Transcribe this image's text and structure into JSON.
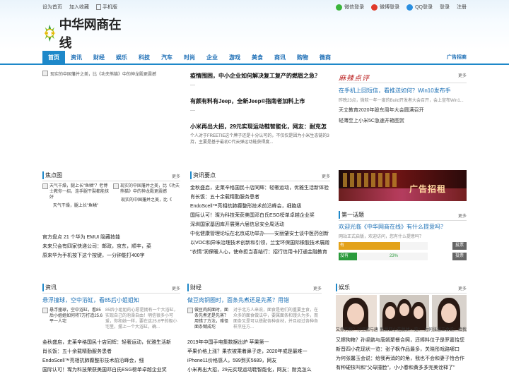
{
  "topbar": {
    "set_home": "设为首页",
    "bookmark": "加入收藏",
    "mobile": "手机版",
    "wechat_login": "微信登录",
    "weibo_login": "微博登录",
    "qq_login": "QQ登录",
    "login": "登录",
    "register": "注册"
  },
  "logo": {
    "text": "中华网商在线"
  },
  "nav": {
    "items": [
      "首页",
      "资讯",
      "财经",
      "娱乐",
      "科技",
      "汽车",
      "时尚",
      "企业",
      "游戏",
      "美食",
      "商讯",
      "购物",
      "微商"
    ],
    "active": 0,
    "ad_link": "广告招商"
  },
  "featured": {
    "image_alt": "现实的中国藩并之美，比《功夫熊猫》中的神龙殿更震撼",
    "headlines": [
      {
        "title": "疫情围困，中小企业如何解决复工复产的燃眉之急？",
        "dash": "—"
      },
      {
        "title": "有颜有料有Jeep，全新Jeep®指南者加料上市",
        "dash": "—"
      },
      {
        "title": "小米再出大招，29元实现运动鞋智能化，网友：耐克怎",
        "desc": "个人对于FREETIE这个牌子还是十分认可的，不仅仅是因为小米生态链的3持，主要是基于最初C代云弹运动鞋获得度..."
      }
    ]
  },
  "review": {
    "title": "麻辣点评",
    "more": "更多",
    "main": "在手机上回短信，看推送如何？Win10发布手",
    "sub": "昨晚23点，微软一年一度的Build开发者大会召开，会上宣布Win1...",
    "items": [
      "天立教育2020年股东周年大会圆满召开",
      "轻薄至上小米5C急速开箱图赏"
    ]
  },
  "focus": {
    "title": "焦点图",
    "more": "更多",
    "pics": [
      {
        "alt": "天气干燥，腿上长\"鱼鳞\"？老博士教你一招，连手腿干裂都能抹好",
        "cap": "天气干燥，腿上长\"鱼鳞\""
      },
      {
        "alt": "现实的中国藩并之美，比《功夫熊猫》中的神龙殿更震撼",
        "cap": "现实的中国藩并之美，比《"
      }
    ],
    "list": [
      "官方盘点 21 个华为 EMUI 隐藏技能",
      "未来只会有四家快递公司：邮政，京东，顺丰，菜",
      "原来华为手机按下这个按键，一分钟能打400字"
    ]
  },
  "news": {
    "title": "资讯要点",
    "more": "更多",
    "items": [
      "金秋盛启，史莱辛格国民十店同辉：轻奢运动，优雅生活新体验",
      "肖长饭：五十余载精勤服务患者",
      "EndoScell™亮相抗肺癫整形技术前沿峰会，细胞级",
      "国际认可！璨为科技荣获美国邓白氏ESG榜单卓越企业奖",
      "深圳国家基因库开展第六届信息安全周活动",
      "中化健康管理论坛在北京成功举办——安丽肇安士谈中医药创新",
      "以VOC和异味治理技术创新和引领，兰宝环保国际橡胶技术展蹭",
      "\"衣情\"润保暖人心，使命担当喜结行：招行信用卡打通金融教育"
    ]
  },
  "topic": {
    "title": "第一话题",
    "more": "更多",
    "question": "欢迎光临《中华网商在线》有什么提意吗？",
    "meta": "网站正式启版，欢迎访问，您有什么提意吗？",
    "votes": [
      {
        "label": "有",
        "percent": 77,
        "pct_text": "77%",
        "color": "#e3a21a",
        "btn": "投票"
      },
      {
        "label": "没有",
        "percent": 23,
        "pct_text": "23%",
        "color": "#2a9a3c",
        "btn": "投票"
      }
    ]
  },
  "ad": {
    "text": "广告招租"
  },
  "zixun": {
    "title": "资讯",
    "more": "更多",
    "headline": "悬浮撞球，空中浴缸，看85后小姐姐知",
    "thumb_alt": "悬浮撞球，空中浴缸，看85后小姐姐如何将7万打造25.6平一人宅",
    "thumb_text": "85后小姐姐的心愿是拥有一个大浴缸，实现自己的泡澡自由！明信很多小可爱，你和她一样，要在这25.6平的极小宅里，摆上一个大浴缸，确...",
    "list": [
      "金秋盛启，史莱辛格国民十店同辉：轻奢运动，优雅生活新",
      "肖长饭：五十余载精勤服务患者",
      "EndoScell™亮相抗肺癫整形技术前沿峰会，细",
      "国际认可！璨为科技荣获美国邓白氏ESG榜单卓越企业奖"
    ]
  },
  "caijing": {
    "title": "财经",
    "more": "更多",
    "headline": "做豆肉铜圈时，面条先煮还是先蒸？用错",
    "thumb_alt": "做豆肉焖面时，面条先煮还是先蒸？用错了方法，难怪面条糊成坨",
    "thumb_text": "对于北方人来说，面食是他们的重要主食，在众多的面食做法中，要属面条和馒头为多，而面条又是可以搭配各种食材，并且经过各种各样烹任方...",
    "list": [
      "2019年中国手电集数据出炉 苹果第一",
      "苹果价格上涨？果农被乘着鼻子走，2020年或是最难一",
      "iPhone11价格感人，599到买5689，网友",
      "小米再出大招，29元实现运动鞋智能化，网友：耐克怎么"
    ]
  },
  "yule": {
    "title": "娱乐",
    "more": "更多",
    "caps": [
      "又擦狗粮？孙坚鹏与唐",
      "新晋四小花脱状一览：",
      "为何张馨玉会说：给我"
    ],
    "list": [
      "又擦狗粮？孙坚鹏与唐嫣聚餐合照，还捧料位子是罗嘉恰您",
      "新晋四小花现状一览：张子枫作品最多，关晓彤戏路哪口",
      "为何张馨玉会说：给我再消的的角，我也不会和妻子恰合作",
      "有种硬核叫和\"父母撞脸\"，小小春和黄多多完美诠释了\""
    ]
  }
}
